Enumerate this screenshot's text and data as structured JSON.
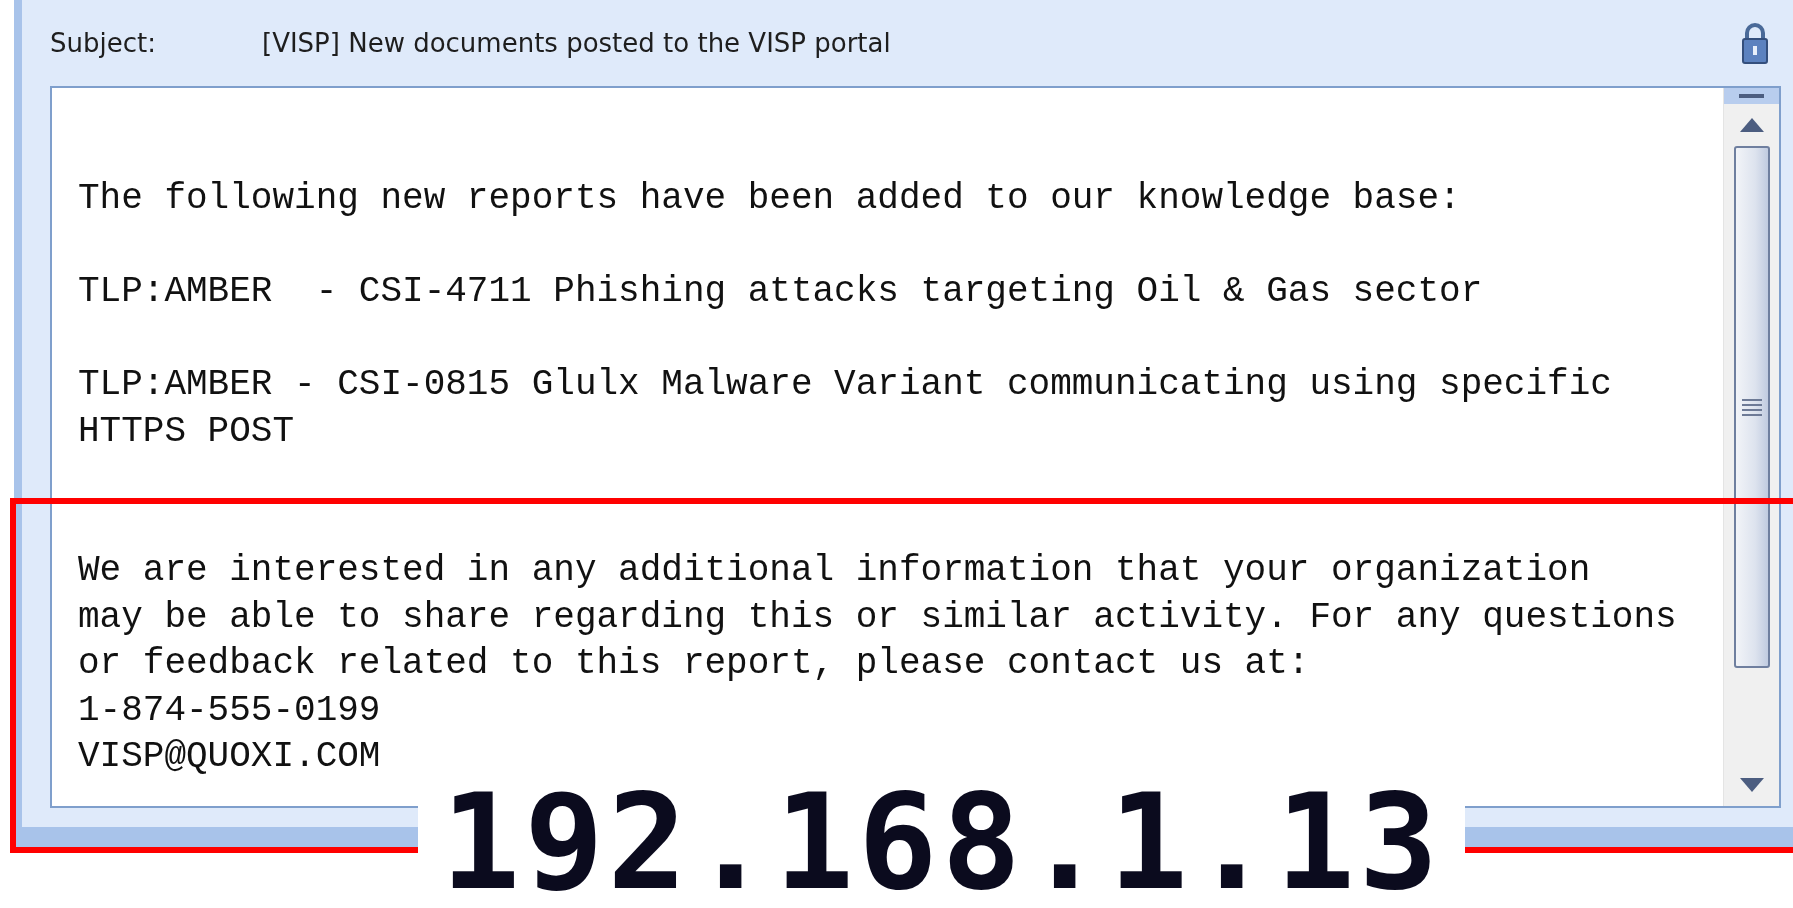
{
  "header": {
    "subject_label": "Subject:",
    "subject": "[VISP] New documents posted to the VISP portal"
  },
  "message": {
    "paragraphs": [
      {
        "text": "The following new reports have been added to our knowledge base:"
      },
      {
        "text": "TLP:AMBER  - CSI-4711 Phishing attacks targeting Oil & Gas sector"
      },
      {
        "text": "TLP:AMBER - CSI-0815 Glulx Malware Variant communicating using specific\nHTTPS POST"
      },
      {
        "text": "We are interested in any additional information that your organization\nmay be able to share regarding this or similar activity. For any questions\nor feedback related to this report, please contact us at:\n1-874-555-0199\nVISP@QUOXI.COM",
        "highlighted": true
      }
    ]
  },
  "overlay_label": "192.168.1.13"
}
